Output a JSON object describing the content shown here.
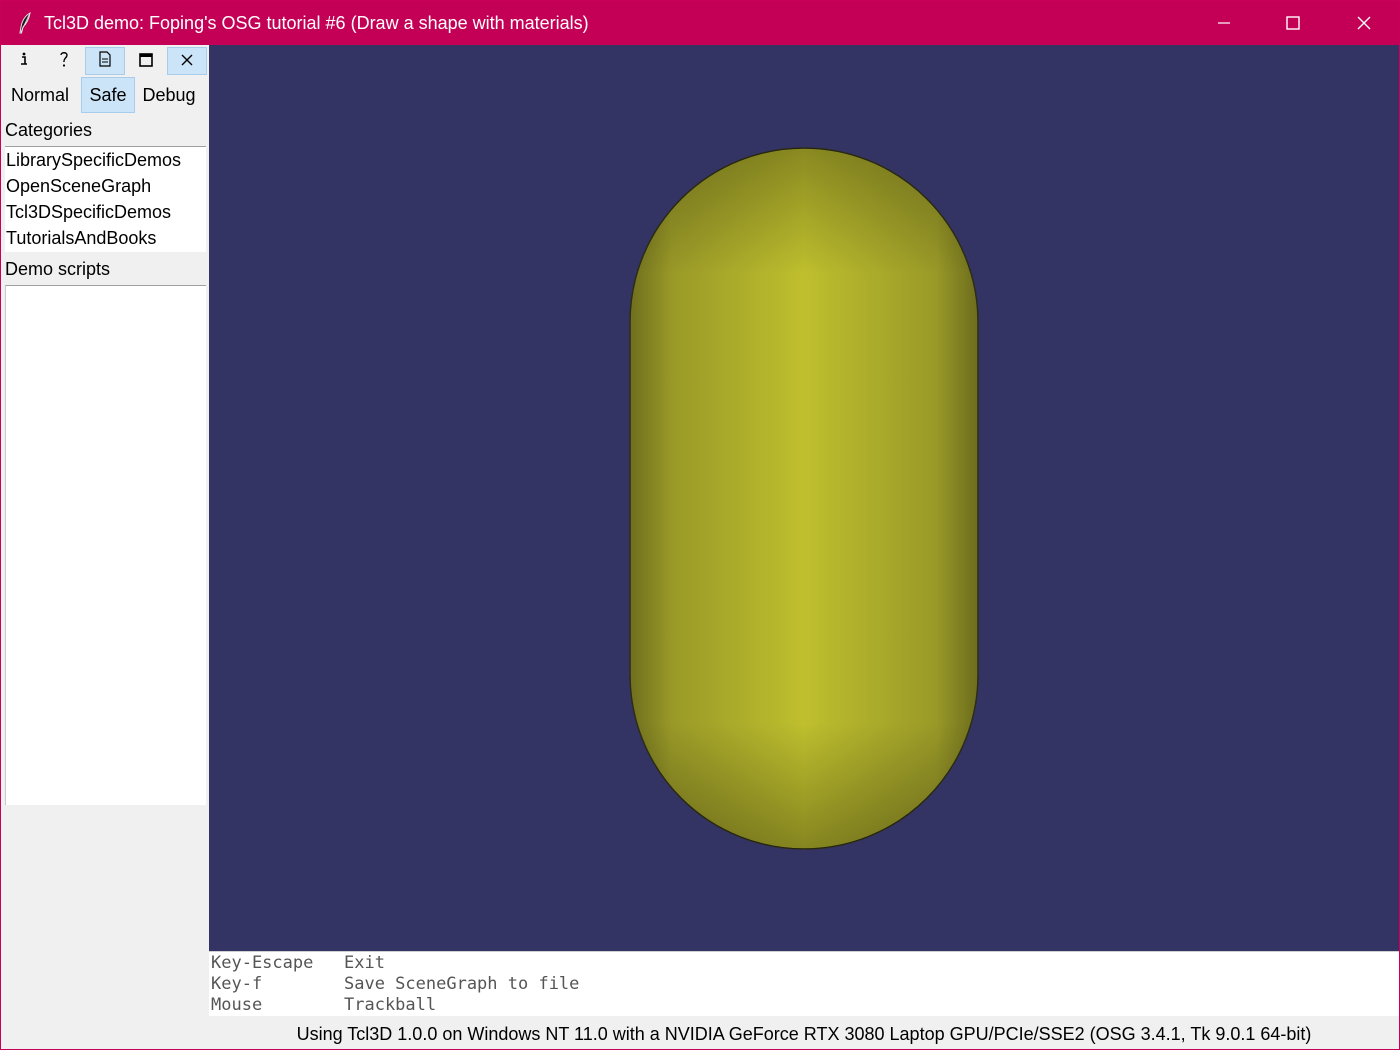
{
  "window": {
    "title": "Tcl3D demo: Foping's OSG tutorial #6 (Draw a shape with materials)",
    "title_bar_color": "#c40056",
    "app_icon": "feather-icon",
    "controls": {
      "minimize_icon": "minimize-icon",
      "maximize_icon": "maximize-icon",
      "close_icon": "close-icon"
    }
  },
  "toolbar": {
    "icons": [
      {
        "name": "info-icon",
        "glyph": "i"
      },
      {
        "name": "help-icon",
        "glyph": "?"
      },
      {
        "name": "document-icon",
        "glyph": "doc"
      },
      {
        "name": "window-icon",
        "glyph": "win"
      },
      {
        "name": "close-icon",
        "glyph": "x"
      }
    ],
    "active_icon": "document-icon"
  },
  "modes": {
    "normal": "Normal",
    "safe": "Safe",
    "debug": "Debug",
    "selected": "Safe"
  },
  "sidebar": {
    "categories_label": "Categories",
    "categories": [
      "LibrarySpecificDemos",
      "OpenSceneGraph",
      "Tcl3DSpecificDemos",
      "TutorialsAndBooks"
    ],
    "demos_label": "Demo scripts",
    "demos": []
  },
  "viewport": {
    "background_color": "#343464",
    "shape": "capsule",
    "shape_color": "#bfbf2e"
  },
  "help": {
    "rows": [
      {
        "key": "Key-Escape",
        "action": "Exit"
      },
      {
        "key": "Key-f",
        "action": "Save SceneGraph to file"
      },
      {
        "key": "Mouse",
        "action": "Trackball"
      }
    ]
  },
  "status": {
    "text": "Using Tcl3D 1.0.0 on Windows NT 11.0 with a NVIDIA GeForce RTX 3080 Laptop GPU/PCIe/SSE2 (OSG 3.4.1, Tk 9.0.1 64-bit)"
  }
}
